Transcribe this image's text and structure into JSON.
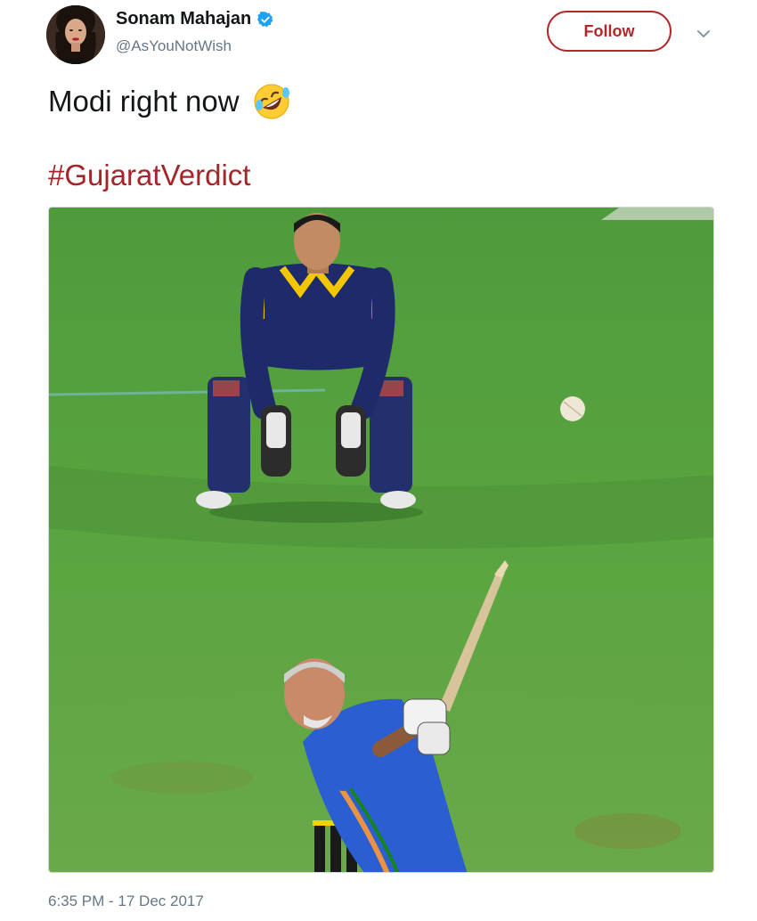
{
  "tweet": {
    "author": {
      "display_name": "Sonam Mahajan",
      "handle": "@AsYouNotWish",
      "verified": true
    },
    "follow_label": "Follow",
    "text": "Modi right now",
    "emoji": "rolling-on-the-floor-laughing-emoji",
    "hashtag": "#GujaratVerdict",
    "timestamp": "6:35 PM - 17 Dec 2017"
  },
  "colors": {
    "accent": "#b3272b",
    "hashtag": "#a5262a",
    "secondary_text": "#657786",
    "verified_badge": "#1da1f2"
  }
}
